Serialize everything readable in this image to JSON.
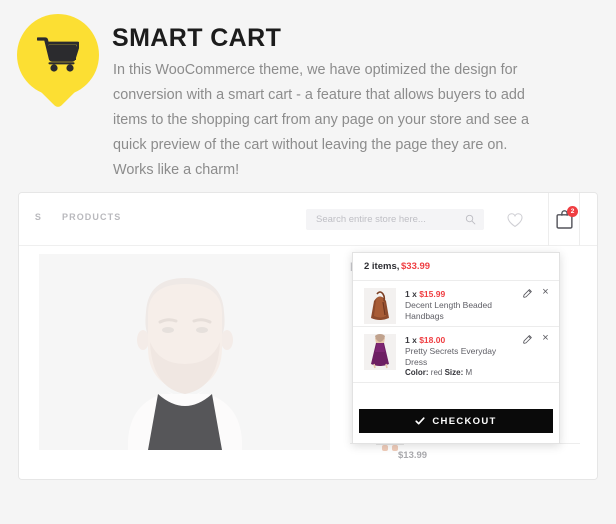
{
  "feature": {
    "icon": "shopping-cart-icon",
    "pin_color": "#fcdf33",
    "title": "SMART CART",
    "body": "In this WooCommerce theme, we have optimized the design for conversion with a smart cart - a feature that allows buyers to add items to the shopping cart from any page on your store and see a quick preview of the cart without leaving the page they are on. Works like a charm!"
  },
  "store": {
    "nav": [
      {
        "label": "S",
        "name": "nav-item-clipped"
      },
      {
        "label": "PRODUCTS",
        "name": "nav-item-products"
      }
    ],
    "search": {
      "placeholder": "Search entire store here...",
      "value": "",
      "icon": "search-icon"
    },
    "wishlist_icon": "heart-icon",
    "cart": {
      "icon": "shopping-bag-icon",
      "badge": "2"
    },
    "catalog": {
      "right_label": "N",
      "second_product_price": "$13.99"
    }
  },
  "mini_cart": {
    "count_label": "2 items,",
    "total": "$33.99",
    "items": [
      {
        "qty_prefix": "1 x ",
        "price": "$15.99",
        "name": "Decent Length Beaded Handbags",
        "variant": "",
        "variant_label_1": "",
        "variant_value_1": "",
        "variant_label_2": "",
        "variant_value_2": "",
        "thumb": "handbag-thumbnail",
        "edit_icon": "pencil-icon",
        "remove_icon": "×"
      },
      {
        "qty_prefix": "1 x ",
        "price": "$18.00",
        "name": "Pretty Secrets Everyday Dress",
        "variant_label_1": "Color:",
        "variant_value_1": " red ",
        "variant_label_2": "Size:",
        "variant_value_2": " M",
        "thumb": "dress-thumbnail",
        "edit_icon": "pencil-icon",
        "remove_icon": "×"
      }
    ],
    "checkout_label": "CHECKOUT",
    "checkout_icon": "check-icon",
    "accent_color": "#ef3e42",
    "checkout_bg": "#0a0a0a"
  }
}
